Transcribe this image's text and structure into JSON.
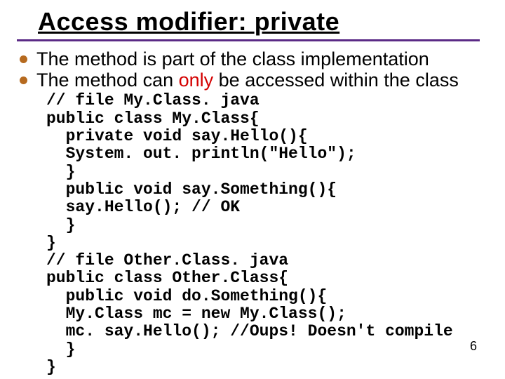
{
  "title": {
    "prefix": "Access modifier: ",
    "keyword": "private"
  },
  "bullets": [
    {
      "text": "The method is part of the class implementation"
    },
    {
      "pre": "The method can ",
      "only": "only",
      "post": " be accessed within the class"
    }
  ],
  "code": {
    "l1": "// file My.Class. java",
    "l2": "public class My.Class{",
    "l3": "  private void say.Hello(){",
    "l4": "  System. out. println(\"Hello\");",
    "l5": "  }",
    "l6": "  public void say.Something(){",
    "l7": "  say.Hello(); // OK",
    "l8": "  }",
    "l9": "}",
    "l10": "// file Other.Class. java",
    "l11": "public class Other.Class{",
    "l12": "  public void do.Something(){",
    "l13": "  My.Class mc = new My.Class();",
    "l14": "  mc. say.Hello(); //Oups! Doesn't compile",
    "l15": "  }",
    "l16": "}"
  },
  "page_number": "6"
}
